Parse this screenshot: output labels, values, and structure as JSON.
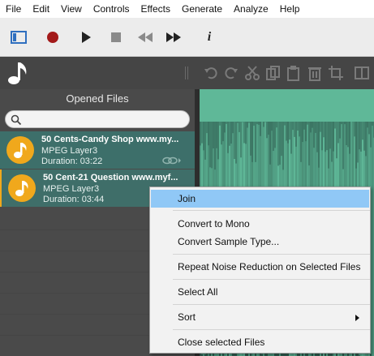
{
  "menu": [
    "File",
    "Edit",
    "View",
    "Controls",
    "Effects",
    "Generate",
    "Analyze",
    "Help"
  ],
  "toolbar": {
    "icons": [
      "layout-icon",
      "record-icon",
      "play-icon",
      "stop-icon",
      "rewind-icon",
      "fast-forward-icon",
      "info-icon"
    ],
    "info_glyph": "i",
    "accent": "#2f6fbf",
    "record_color": "#a31a1a"
  },
  "sidebar": {
    "title": "Opened Files",
    "search_placeholder": "",
    "files": [
      {
        "title": "50 Cents-Candy Shop www.my...",
        "format": "MPEG Layer3",
        "duration": "Duration: 03:22"
      },
      {
        "title": "50 Cent-21 Question www.myf...",
        "format": "MPEG Layer3",
        "duration": "Duration: 03:44"
      }
    ],
    "file_color": "#3d6f6a",
    "badge_color": "#f0a81c"
  },
  "waveform": {
    "color": "#5fb898",
    "background": "#2e5c4f"
  },
  "context_menu": {
    "join": "Join",
    "convert_mono": "Convert to Mono",
    "convert_sample": "Convert Sample Type...",
    "repeat_noise": "Repeat Noise Reduction on Selected Files",
    "select_all": "Select All",
    "sort": "Sort",
    "close_selected": "Close selected Files",
    "highlight_color": "#90c8f6"
  }
}
